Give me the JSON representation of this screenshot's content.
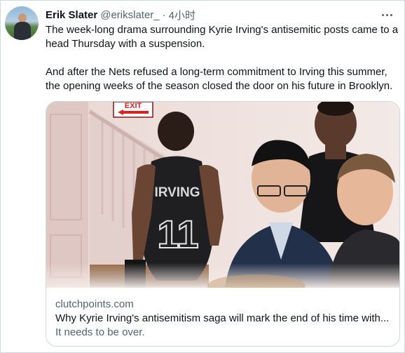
{
  "tweet": {
    "author_name": "Erik Slater",
    "handle": "@erikslater_",
    "separator": "·",
    "time": "4小时",
    "paragraphs": [
      "The week-long drama surrounding Kyrie Irving's antisemitic posts came to a head Thursday with a suspension.",
      "And after the Nets refused a long-term commitment to Irving this summer, the opening weeks of the season closed the door on his future in Brooklyn."
    ]
  },
  "card": {
    "domain": "clutchpoints.com",
    "title": "Why Kyrie Irving's antisemitism saga will mark the end of his time with...",
    "description": "It needs to be over.",
    "image": {
      "exit_sign": "EXIT",
      "jersey_name": "IRVING",
      "jersey_number": "11"
    }
  },
  "icons": {
    "more": "more-horizontal-icon",
    "avatar": "user-avatar"
  }
}
